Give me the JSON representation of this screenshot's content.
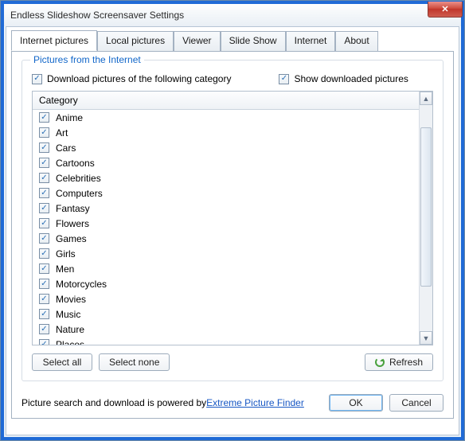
{
  "window": {
    "title": "Endless Slideshow Screensaver Settings"
  },
  "tabs": [
    {
      "label": "Internet pictures",
      "active": true
    },
    {
      "label": "Local pictures"
    },
    {
      "label": "Viewer"
    },
    {
      "label": "Slide Show"
    },
    {
      "label": "Internet"
    },
    {
      "label": "About"
    }
  ],
  "group": {
    "legend": "Pictures from the Internet",
    "download_label": "Download pictures of the following category",
    "download_checked": true,
    "show_label": "Show downloaded pictures",
    "show_checked": true
  },
  "category_header": "Category",
  "categories": [
    {
      "label": "Anime",
      "checked": true
    },
    {
      "label": "Art",
      "checked": true
    },
    {
      "label": "Cars",
      "checked": true
    },
    {
      "label": "Cartoons",
      "checked": true
    },
    {
      "label": "Celebrities",
      "checked": true
    },
    {
      "label": "Computers",
      "checked": true
    },
    {
      "label": "Fantasy",
      "checked": true
    },
    {
      "label": "Flowers",
      "checked": true
    },
    {
      "label": "Games",
      "checked": true
    },
    {
      "label": "Girls",
      "checked": true
    },
    {
      "label": "Men",
      "checked": true
    },
    {
      "label": "Motorcycles",
      "checked": true
    },
    {
      "label": "Movies",
      "checked": true
    },
    {
      "label": "Music",
      "checked": true
    },
    {
      "label": "Nature",
      "checked": true
    },
    {
      "label": "Places",
      "checked": true
    }
  ],
  "buttons": {
    "select_all": "Select all",
    "select_none": "Select none",
    "refresh": "Refresh",
    "ok": "OK",
    "cancel": "Cancel"
  },
  "footer": {
    "prefix": "Picture search and download is powered by ",
    "link": "Extreme Picture Finder"
  }
}
